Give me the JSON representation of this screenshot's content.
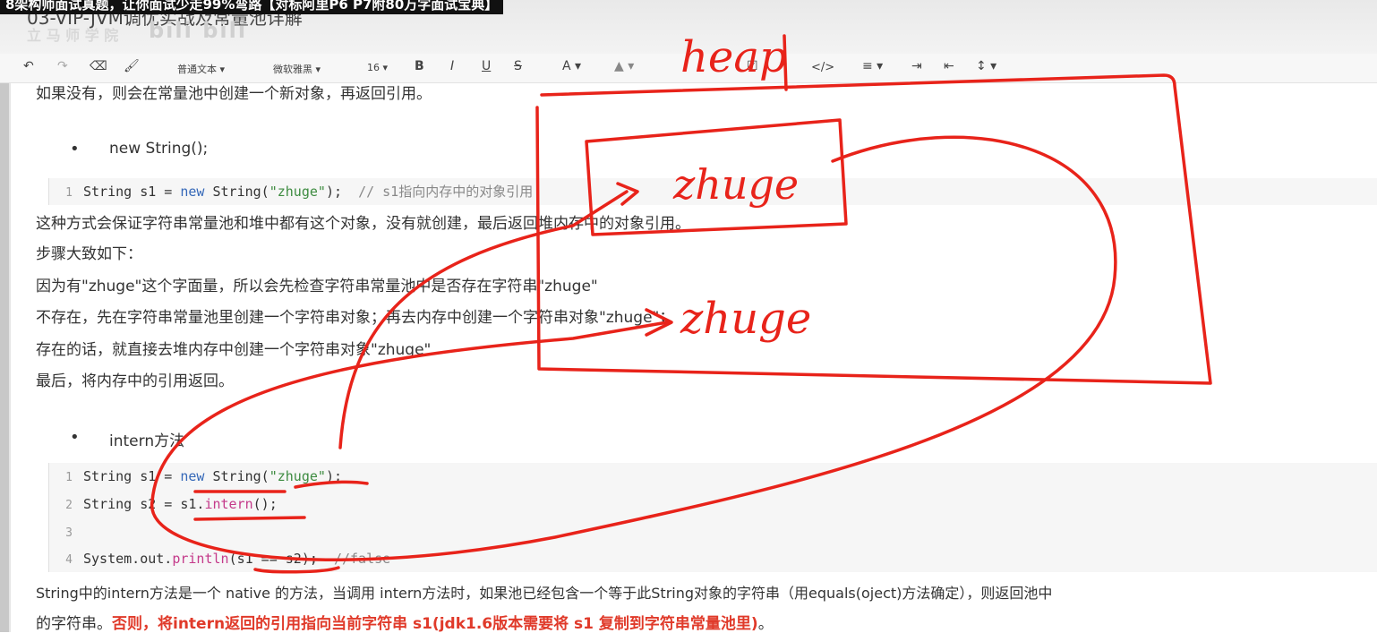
{
  "title_bar": {
    "banner": "8架构师面试真题，让你面试少走99%弯路【对标阿里P6 P7附80万字面试宝典】",
    "doc_title": "03-VIP-JVM调优实战及常量池详解",
    "watermark": "立 马 师 学 院",
    "watermark2": "bili bili"
  },
  "toolbar": {
    "undo": "↶",
    "redo": "↷",
    "clear": "⌫",
    "brush": "🖌",
    "paragraph": "普通文本 ▾",
    "font": "微软雅黑 ▾",
    "size": "16 ▾",
    "bold": "B",
    "italic": "I",
    "underline": "U",
    "strike": "S",
    "font_color": "A ▾",
    "highlight": "▲ ▾",
    "checkbox": "☑",
    "quote": "❝",
    "code": "</>",
    "list": "≡ ▾",
    "indent": "⇥",
    "outdent": "⇤",
    "line_height": "↕ ▾"
  },
  "content": {
    "line0": "如果没有，则会在常量池中创建一个新对象，再返回引用。",
    "bullet1": "new String();",
    "code1": {
      "ln": "1",
      "a": "String s1 = ",
      "kw": "new",
      "b": " String(",
      "str": "\"zhuge\"",
      "c": ");  ",
      "cm": "// s1指向内存中的对象引用"
    },
    "p1": "这种方式会保证字符串常量池和堆中都有这个对象，没有就创建，最后返回堆内存中的对象引用。",
    "p2": "步骤大致如下：",
    "p3": "因为有\"zhuge\"这个字面量，所以会先检查字符串常量池中是否存在字符串\"zhuge\"",
    "p4": "不存在，先在字符串常量池里创建一个字符串对象；再去内存中创建一个字符串对象\"zhuge\"；",
    "p5": "存在的话，就直接去堆内存中创建一个字符串对象\"zhuge\"",
    "p6": "最后，将内存中的引用返回。",
    "bullet2": "intern方法",
    "code2": {
      "l1": {
        "ln": "1",
        "a": "String s1 = ",
        "kw": "new",
        "b": " String(",
        "str": "\"zhuge\"",
        "c": ");"
      },
      "l2": {
        "ln": "2",
        "a": "String s2 = s1.",
        "fn": "intern",
        "c": "();"
      },
      "l3": {
        "ln": "3"
      },
      "l4": {
        "ln": "4",
        "a": "System.out.",
        "fn": "println",
        "b": "(s1 == s2);  ",
        "cm": "//false"
      }
    },
    "p7": "String中的intern方法是一个 native 的方法，当调用 intern方法时，如果池已经包含一个等于此String对象的字符串（用equals(oject)方法确定），则返回池中",
    "p8_a": "的字符串。",
    "p8_red": "否则，将intern返回的引用指向当前字符串 s1(jdk1.6版本需要将 s1 复制到字符串常量池里)",
    "p8_end": "。"
  },
  "annotations": {
    "heap": "heap",
    "zhuge_pool": "zhuge",
    "zhuge_heap": "zhuge",
    "stroke_color": "#e8231a"
  }
}
